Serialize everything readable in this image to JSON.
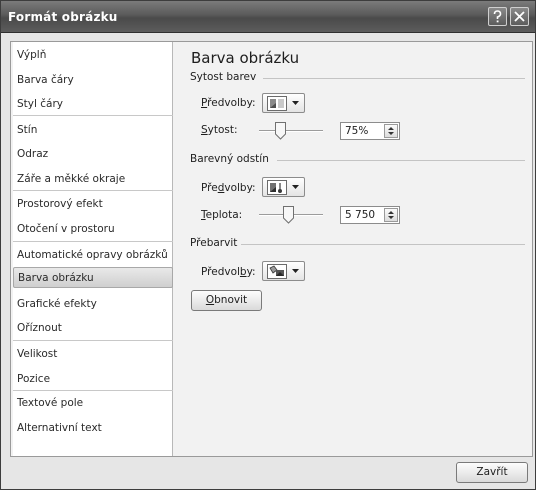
{
  "window": {
    "title": "Formát obrázku",
    "help_glyph": "?",
    "close_glyph": "×"
  },
  "nav": {
    "items": [
      {
        "label": "Výplň"
      },
      {
        "label": "Barva čáry"
      },
      {
        "label": "Styl čáry"
      },
      {
        "label": "Stín"
      },
      {
        "label": "Odraz"
      },
      {
        "label": "Záře a měkké okraje"
      },
      {
        "label": "Prostorový efekt"
      },
      {
        "label": "Otočení v prostoru"
      },
      {
        "label": "Automatické opravy obrázků"
      },
      {
        "label": "Barva obrázku",
        "selected": true
      },
      {
        "label": "Grafické efekty"
      },
      {
        "label": "Oříznout"
      },
      {
        "label": "Velikost"
      },
      {
        "label": "Pozice"
      },
      {
        "label": "Textové pole"
      },
      {
        "label": "Alternativní text"
      }
    ]
  },
  "content": {
    "heading": "Barva obrázku",
    "saturation_group": {
      "title": "Sytost barev",
      "presets_label_pre": "",
      "presets_label_u": "P",
      "presets_label_post": "ředvolby:",
      "presets_icon": "saturation-preset-icon",
      "value_label_u": "S",
      "value_label_post": "ytost:",
      "value": "75%",
      "value_fraction": 0.3
    },
    "tone_group": {
      "title": "Barevný odstín",
      "presets_label_pre": "Pře",
      "presets_label_u": "d",
      "presets_label_post": "volby:",
      "presets_icon": "tone-preset-icon",
      "value_label_u": "T",
      "value_label_post": "eplota:",
      "value": "5 750",
      "value_fraction": 0.45
    },
    "recolor_group": {
      "title": "Přebarvit",
      "presets_label_pre": "Předvol",
      "presets_label_u": "b",
      "presets_label_post": "y:",
      "presets_icon": "recolor-preset-icon"
    },
    "reset_button": {
      "label_u": "O",
      "label_post": "bnovit"
    }
  },
  "footer": {
    "close_button": "Zavřít"
  },
  "colors": {
    "titlebar": "#5a5a5a",
    "panel_bg": "#f2f2f2",
    "selected_item": "#d6d6d6"
  }
}
